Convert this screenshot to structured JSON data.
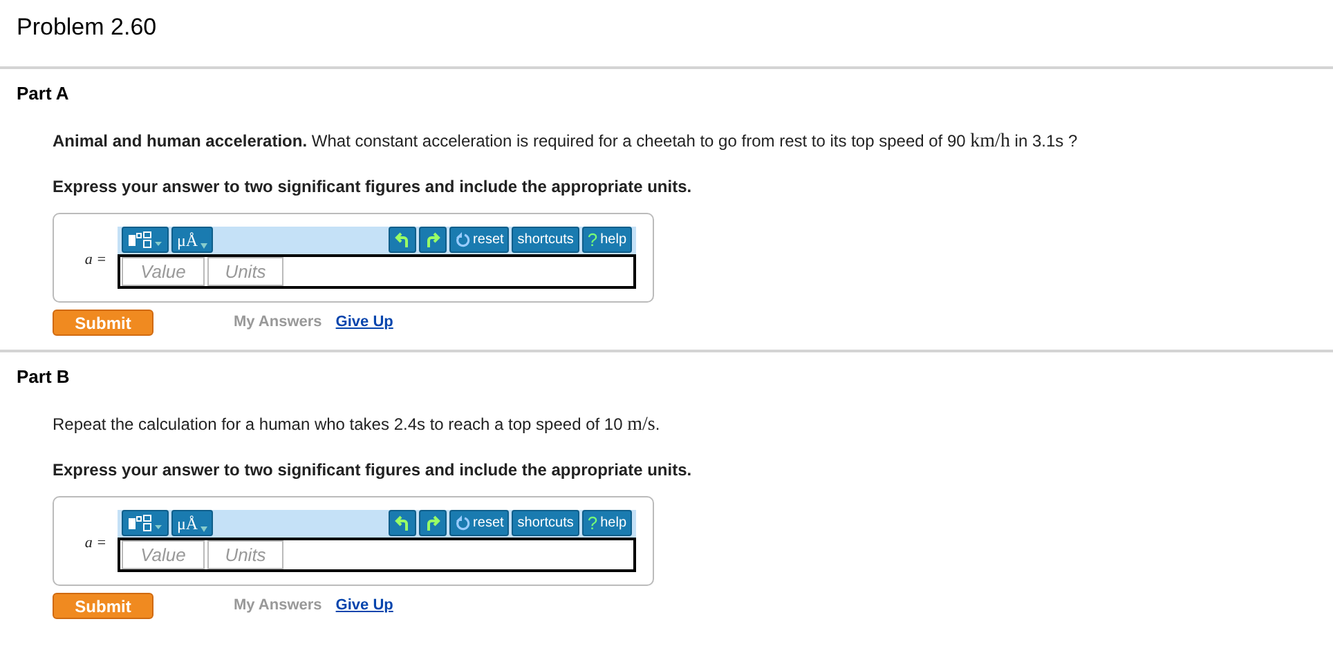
{
  "title": "Problem 2.60",
  "parts": [
    {
      "label": "Part A",
      "question": [
        {
          "kind": "text",
          "text": "**Animal and human acceleration.** What constant acceleration is required for a cheetah to go from rest to its top speed of 90 "
        },
        {
          "kind": "math",
          "text": "km/h"
        },
        {
          "kind": "text",
          "text": " in 3.1s ?"
        }
      ],
      "instruction": "Express your answer to two significant figures and include the appropriate units.",
      "variable": "a =",
      "units_menu": "μÅ",
      "reset": "reset",
      "shortcuts": "shortcuts",
      "help_mark": "?",
      "help": "help",
      "value_placeholder": "Value",
      "units_placeholder": "Units",
      "submit": "Submit",
      "my_answers": "My Answers",
      "give_up": "Give Up"
    },
    {
      "label": "Part B",
      "question": [
        {
          "kind": "text",
          "text": "Repeat the calculation for a human who takes 2.4s to reach a top speed of 10 "
        },
        {
          "kind": "math",
          "text": "m/s"
        },
        {
          "kind": "text",
          "text": "."
        }
      ],
      "instruction": "Express your answer to two significant figures and include the appropriate units.",
      "variable": "a =",
      "units_menu": "μÅ",
      "reset": "reset",
      "shortcuts": "shortcuts",
      "help_mark": "?",
      "help": "help",
      "value_placeholder": "Value",
      "units_placeholder": "Units",
      "submit": "Submit",
      "my_answers": "My Answers",
      "give_up": "Give Up"
    }
  ]
}
